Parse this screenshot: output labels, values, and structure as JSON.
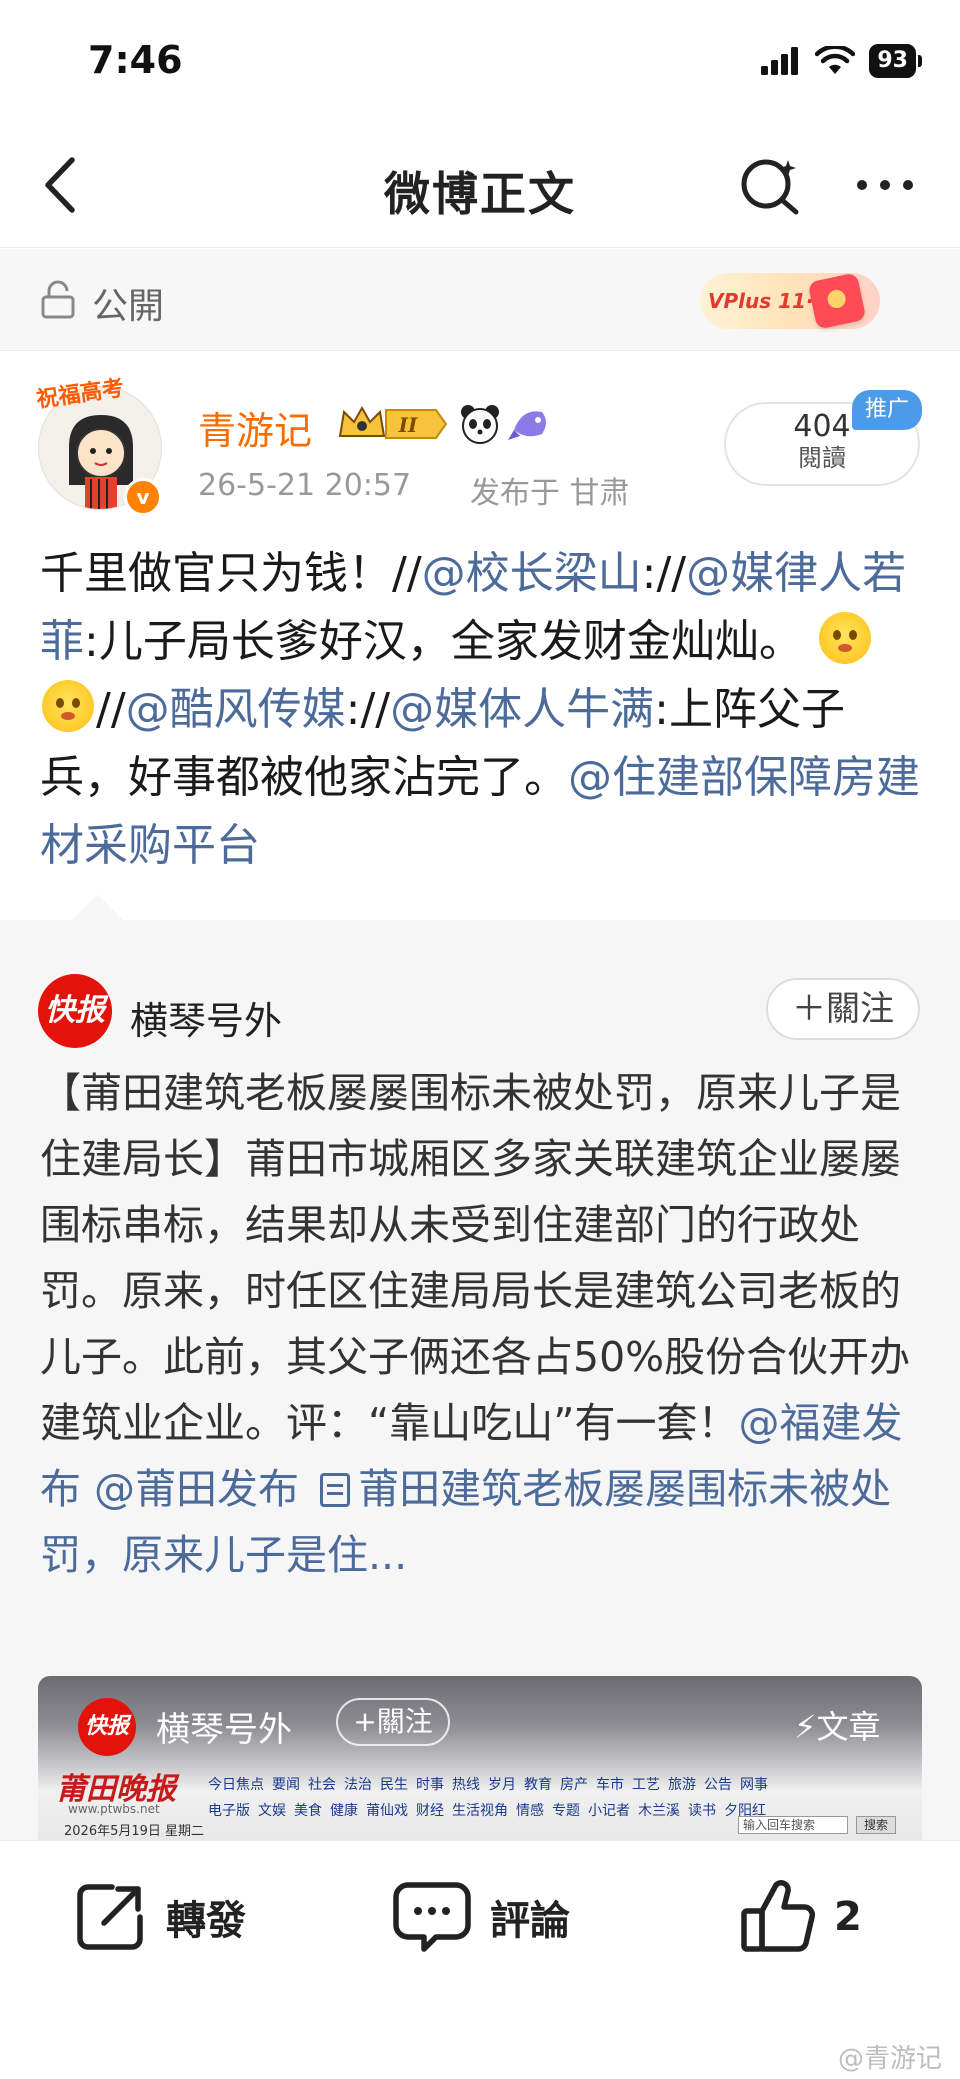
{
  "status": {
    "time": "7:46",
    "battery": "93"
  },
  "nav": {
    "title": "微博正文"
  },
  "visibility": {
    "label": "公開",
    "vplus": "VPlus 11·11"
  },
  "author": {
    "name": "青游记",
    "avatar_badge": "祝福高考",
    "level": "II",
    "time": "26-5-21 20:57",
    "location": "发布于 甘肃",
    "reads": "404",
    "reads_label": "閱讀",
    "promo": "推广"
  },
  "post": {
    "t1": "千里做官只为钱！//",
    "m1": "@校长梁山",
    "t2": "://",
    "m2": "@媒律人若菲",
    "t3": ":儿子局长爹好汉，全家发财金灿灿。 ",
    "t4": "//",
    "m3": "@酷风传媒",
    "t5": "://",
    "m4": "@媒体人牛满",
    "t6": ":上阵父子兵，好事都被他家沾完了。",
    "m5": "@住建部保障房建材采购平台"
  },
  "repost": {
    "logo": "快报",
    "author": "横琴号外",
    "follow": "＋關注",
    "text": "【莆田建筑老板屡屡围标未被处罚，原来儿子是住建局长】莆田市城厢区多家关联建筑企业屡屡围标串标，结果却从未受到住建部门的行政处罚。原来，时任区住建局局长是建筑公司老板的儿子。此前，其父子俩还各占50%股份合伙开办建筑业企业。评：“靠山吃山”有一套！",
    "mention1": "@福建发布",
    "mention2": "@莆田发布",
    "link_text": "莆田建筑老板屡屡围标未被处罚，原来儿子是住..."
  },
  "preview": {
    "logo": "快报",
    "author": "横琴号外",
    "follow": "+關注",
    "article": "⚡文章",
    "masthead": "莆田晚报",
    "url": "www.ptwbs.net",
    "date": "2026年5月19日 星期二",
    "menu1": [
      "今日焦点",
      "要闻",
      "社会",
      "法治",
      "民生",
      "时事",
      "热线",
      "岁月",
      "教育",
      "房产",
      "车市",
      "工艺",
      "旅游",
      "公告",
      "网事"
    ],
    "menu2": [
      "电子版",
      "文娱",
      "美食",
      "健康",
      "莆仙戏",
      "财经",
      "生活视角",
      "情感",
      "专题",
      "小记者",
      "木兰溪",
      "读书",
      "夕阳红"
    ],
    "search_placeholder": "输入回车搜索",
    "search_btn": "搜索"
  },
  "actions": {
    "repost": "轉發",
    "comment": "評論",
    "like_count": "2"
  },
  "watermark": "@青游记",
  "colors": {
    "accent_orange": "#f86d00",
    "mention_blue": "#4c6b9a",
    "promo_blue": "#4c9be8",
    "brand_red": "#e3120b"
  }
}
